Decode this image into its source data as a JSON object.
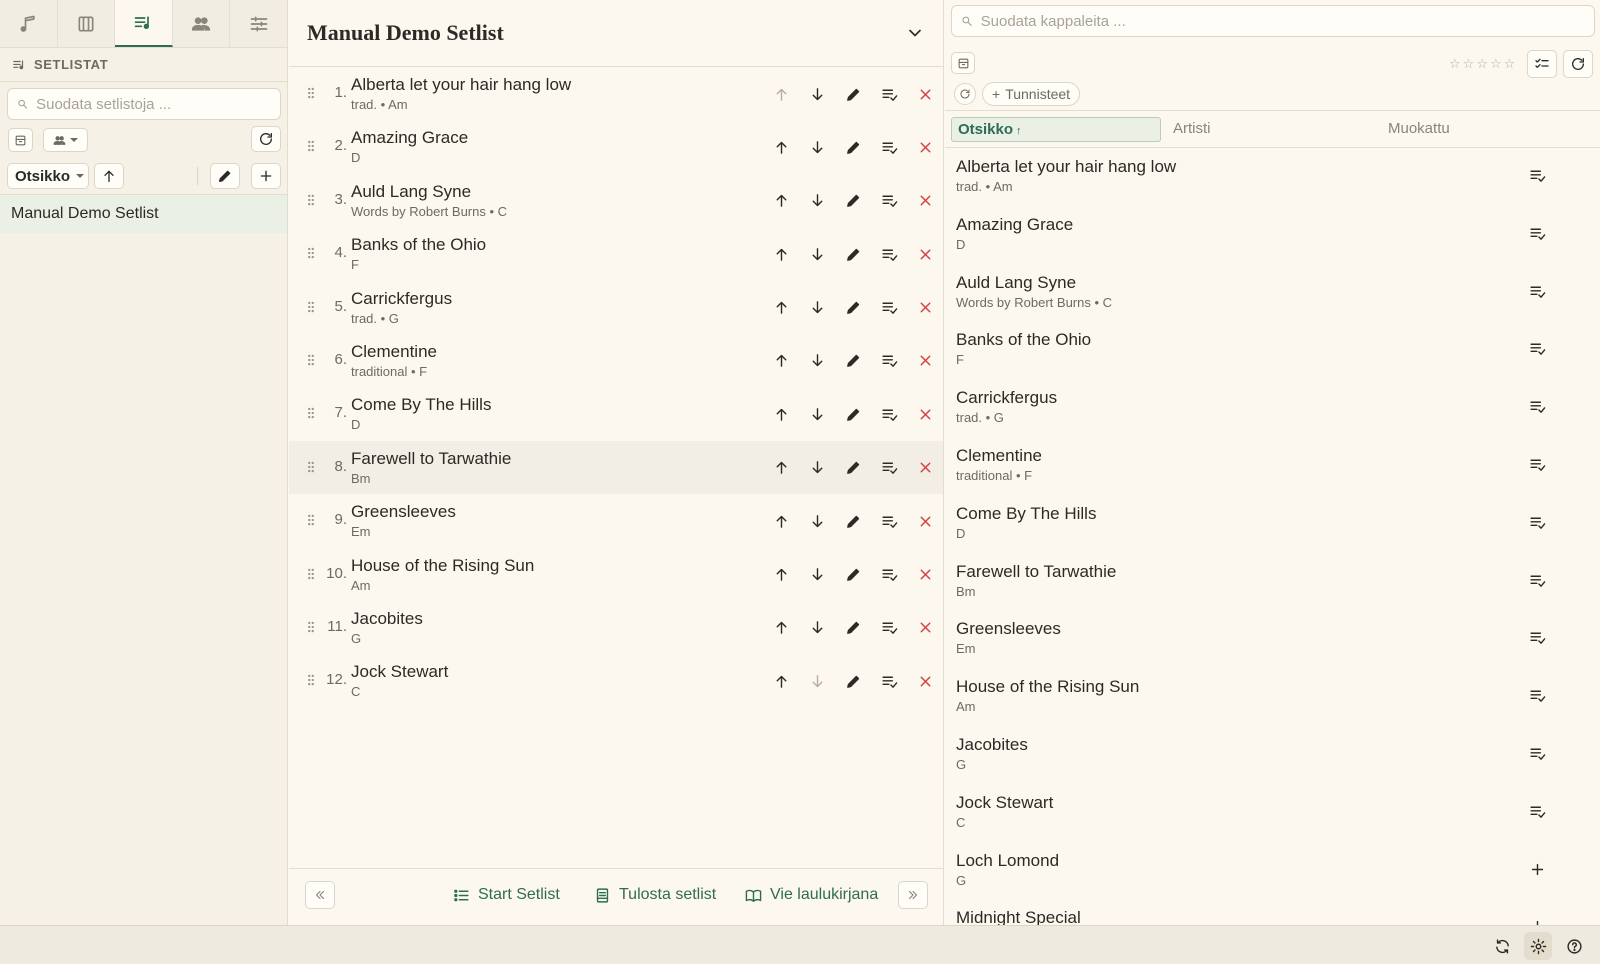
{
  "nav": {
    "tabs": [
      {
        "name": "nav-tab-songs",
        "icon": "music-note-icon"
      },
      {
        "name": "nav-tab-songbooks",
        "icon": "book-icon"
      },
      {
        "name": "nav-tab-setlists",
        "icon": "playlist-icon",
        "active": true
      },
      {
        "name": "nav-tab-groups",
        "icon": "people-icon"
      },
      {
        "name": "nav-tab-settings",
        "icon": "sliders-icon"
      }
    ]
  },
  "left": {
    "heading": "SETLISTAT",
    "filter_placeholder": "Suodata setlistoja ...",
    "sort_label": "Otsikko",
    "setlists": [
      "Manual Demo Setlist"
    ]
  },
  "center": {
    "title": "Manual Demo Setlist",
    "songs": [
      {
        "num": "1.",
        "title": "Alberta let your hair hang low",
        "sub": "trad. • Am"
      },
      {
        "num": "2.",
        "title": "Amazing Grace",
        "sub": "D"
      },
      {
        "num": "3.",
        "title": "Auld Lang Syne",
        "sub": "Words by Robert Burns • C"
      },
      {
        "num": "4.",
        "title": "Banks of the Ohio",
        "sub": "F"
      },
      {
        "num": "5.",
        "title": "Carrickfergus",
        "sub": "trad. • G"
      },
      {
        "num": "6.",
        "title": "Clementine",
        "sub": "traditional • F"
      },
      {
        "num": "7.",
        "title": "Come By The Hills",
        "sub": "D"
      },
      {
        "num": "8.",
        "title": "Farewell to Tarwathie",
        "sub": "Bm"
      },
      {
        "num": "9.",
        "title": "Greensleeves",
        "sub": "Em"
      },
      {
        "num": "10.",
        "title": "House of the Rising Sun",
        "sub": "Am"
      },
      {
        "num": "11.",
        "title": "Jacobites",
        "sub": "G"
      },
      {
        "num": "12.",
        "title": "Jock Stewart",
        "sub": "C"
      }
    ],
    "footer": {
      "start_label": "Start Setlist",
      "print_label": "Tulosta setlist",
      "export_label": "Vie laulukirjana"
    }
  },
  "right": {
    "filter_placeholder": "Suodata kappaleita ...",
    "tags_label": "Tunnisteet",
    "columns": {
      "title": "Otsikko",
      "artist": "Artisti",
      "modified": "Muokattu"
    },
    "songs": [
      {
        "title": "Alberta let your hair hang low",
        "sub": "trad. • Am",
        "in_setlist": true
      },
      {
        "title": "Amazing Grace",
        "sub": "D",
        "in_setlist": true
      },
      {
        "title": "Auld Lang Syne",
        "sub": "Words by Robert Burns • C",
        "in_setlist": true
      },
      {
        "title": "Banks of the Ohio",
        "sub": "F",
        "in_setlist": true
      },
      {
        "title": "Carrickfergus",
        "sub": "trad. • G",
        "in_setlist": true
      },
      {
        "title": "Clementine",
        "sub": "traditional • F",
        "in_setlist": true
      },
      {
        "title": "Come By The Hills",
        "sub": "D",
        "in_setlist": true
      },
      {
        "title": "Farewell to Tarwathie",
        "sub": "Bm",
        "in_setlist": true
      },
      {
        "title": "Greensleeves",
        "sub": "Em",
        "in_setlist": true
      },
      {
        "title": "House of the Rising Sun",
        "sub": "Am",
        "in_setlist": true
      },
      {
        "title": "Jacobites",
        "sub": "G",
        "in_setlist": true
      },
      {
        "title": "Jock Stewart",
        "sub": "C",
        "in_setlist": true
      },
      {
        "title": "Loch Lomond",
        "sub": "G",
        "in_setlist": false
      },
      {
        "title": "Midnight Special",
        "sub": "",
        "in_setlist": false
      }
    ]
  },
  "colors": {
    "accent": "#2e6d52",
    "danger": "#d43e3e",
    "background": "#fcf8ef",
    "panel": "#f6f1e6"
  }
}
